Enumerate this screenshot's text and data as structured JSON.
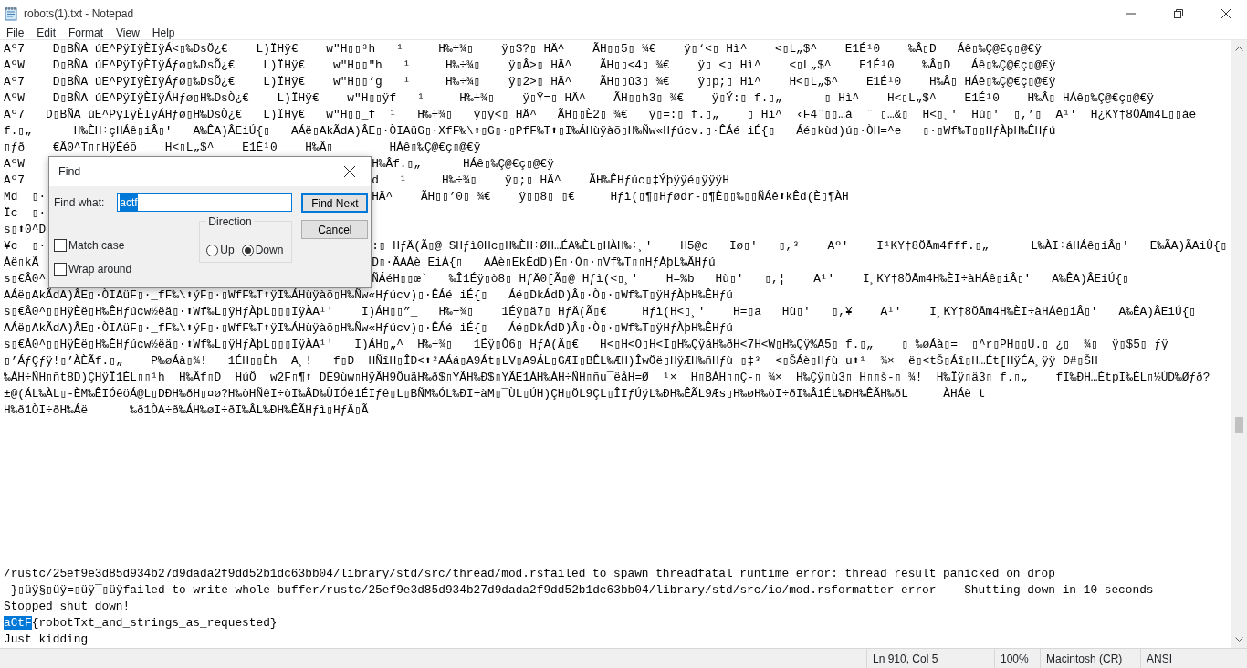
{
  "window": {
    "title": "robots(1).txt - Notepad"
  },
  "menu": [
    "File",
    "Edit",
    "Format",
    "View",
    "Help"
  ],
  "editor": {
    "upper_lines": [
      {
        "kind": "plain",
        "text": "Aº7    D▯BÑA úE^PÿIÿÈIÿÁ<▯‰DsÖ¿€    L)ÏHÿ€    w\"H▯▯³h   ¹     H‰÷¾▯    ÿ▯S?▯ HÄ^    ÃH▯▯5▯ ¾€    ÿ▯‘<▯ Hì^    <▯L„$^    E1É¹0    ‰Â▯D   Áê▯‰Ç@€ç▯@€ÿ"
      },
      {
        "kind": "plain",
        "text": "AºW    D▯BÑA úE^PÿIÿÈIÿÁƒø▯‰DsÕ¿€    L)ÏHÿ€    w\"H▯▯\"h   ¹     H‰÷¾▯    ÿ▯Â>▯ HÄ^    ÃH▯▯<4▯ ¾€    ÿ▯ <▯ Hì^    <▯L„$^    E1É¹0    ‰Â▯D   Áê▯‰Ç@€ç▯@€ÿ"
      },
      {
        "kind": "plain",
        "text": "Aº7    D▯BÑA úE^PÿIÿÈIÿÁƒø▯‰DsÕ¿€    L)ÏHÿ€    w\"H▯▯’g   ¹     H‰÷¾▯    ÿ▯2>▯ HÄ^    ÃH▯▯û3▯ ¾€    ÿ▯p;▯ Hì^    H<▯L„$^    E1É¹0    H‰Â▯ HÁê▯‰Ç@€ç▯@€ÿ"
      },
      {
        "kind": "plain",
        "text": "AºW    D▯BÑA úE^PÿIÿÈIÿÁHƒø▯H‰DsÒ¿€    L)ÏHÿ€    w\"H▯▯ÿf   ¹     H‰÷¾▯    ÿ▯Ÿ=▯ HÄ^    ÃH▯▯h3▯ ¾€    ÿ▯Ý:▯ f.▯„      ▯ Hì^    H<▯L„$^    E1É¹0    H‰Â▯ HÁê▯‰Ç@€ç▯@€ÿ"
      },
      {
        "kind": "plain",
        "text": "Aº7   D▯BÑA úE^PÿIÿÈIÿÁHƒø▯H‰DsÒ¿€   L)ÏHÿ€   w\"H▯▯_f  ¹   H‰÷¾▯   ÿ▯ÿ<▯ HÄ^   ÃH▯▯È2▯ ¾€   ÿ▯=:▯ f.▯„    ▯ Hì^  ‹F4¨▯▯…à  ¨ ▯…&▯  H<▯¸'  Hù▯'  ▯,’▯  A¹'  H¿KY†8ÖÅm4L▯▯áe"
      },
      {
        "kind": "plain",
        "text": "f.▯„      H‰ÈH÷çHÁê▯iÂ▯'   A‰ÊA)ÂEiÚ{▯   AÁë▯AkÃdA)ÂE▯·ÒIAüG▯·XfF‰\\⬆▯G▯·▯PfF‰T⬆▯I‰ÁHùÿàõ▯H‰Ñw«Hƒúcv.▯·ÊÁé iÉ{▯   Áé▯kùd)ú▯·ÒH=^e   ▯·▯Wf‰T▯▯HƒÀþH‰ÊHƒú"
      },
      {
        "kind": "plain",
        "text": "▯ƒð    €Â0^T▯▯HÿÈéõ    H<▯L„$^    E1É¹0    H‰Â▯        HÁê▯‰Ç@€ç▯@€ÿ"
      },
      {
        "kind": "split",
        "left": "AºW",
        "right": "H‰Âf.▯„      HÁê▯‰Ç@€ç▯@€ÿ"
      },
      {
        "kind": "split",
        "left": "Aº7",
        "right": "d   ¹     H‰÷¾▯    ÿ▯;▯ HÄ^    ÃH‰ÊHƒúc▯‡Ýþÿÿé▯ÿÿÿH"
      },
      {
        "kind": "split",
        "left": "Md  ▯·",
        "right": "HÄ^    ÃH▯▯’0▯ ¾€    ÿ▯▯8▯ ▯€     Hƒì(▯¶▯Hƒødr-▯¶È▯▯‰▯▯ÑÁê⬆kÊd(È▯¶ÀH"
      },
      {
        "kind": "split",
        "left": "Ïc  ▯·"
      },
      {
        "kind": "split",
        "left": "s▯⬆0^D"
      },
      {
        "kind": "split",
        "left": "¥c  ▯·",
        "right": ":▯ HƒÄ(Ã▯@ SHƒì0Hc▯H‰ÈH÷ØH…ÉA‰ÈL▯HÀH‰÷¸'    H5@c   Iø▯'   ▯,³    Aº'    I¹KY†8ÖÅm4fff.▯„      L‰ÀI÷áHÁê▯iÂ▯'   E‰ÃA)ÃAiÛ{▯"
      },
      {
        "kind": "split",
        "left": "Áë▯kÃ",
        "right": "D▯·ÂAÁè EiÀ{▯   AÁè▯EkÈdD)Ê▯·Ò▯·▯Vf‰T▯▯HƒÀþL‰ÂHƒú"
      },
      {
        "kind": "split",
        "left": "s▯€Â0^",
        "right": "ÑÁéH▯▯œ`   ‰Î1Éÿ▯ò8▯ HƒÄ0[Ã▯@ Hƒì(<▯¸'    H=%b   Hù▯'   ▯,¦    A¹'    I¸KY†8ÖÅm4H‰ÈI÷àHÁê▯iÂ▯'   A‰ÊA)ÂEiÚ{▯"
      },
      {
        "kind": "plain",
        "text": "AÁë▯AkÃdA)ÂE▯·ÒIAüF▯·_fF‰\\⬆ýF▯·▯WfF‰T⬆ÿI‰ÁHùÿàõ▯H‰Ñw«Hƒúcv)▯·ÊÁé iÉ{▯   Áé▯DkÁdD)Â▯·Ò▯·▯Wf‰T▯ÿHƒÀþH‰ÊHƒú"
      },
      {
        "kind": "plain",
        "text": "s▯€Â0^▯▯HÿÈë▯H‰ÊHƒúcw½ëä▯·⬆Wf‰L▯ÿHƒÀþL▯▯▯IÿÀA¹'    I)ÁH▯▯”_   H‰÷¾▯    1Éÿ▯ä7▯ HƒÄ(Ã▯€     Hƒì(H<▯¸'    H=▯a   Hù▯'   ▯,¥    A¹'    I¸KY†8ÖÅm4H‰ÈI÷àHÁê▯iÂ▯'   A‰ÊA)ÂEiÚ{▯"
      },
      {
        "kind": "plain",
        "text": "AÁë▯AkÃdA)ÂE▯·ÒIAüF▯·_fF‰\\⬆ýF▯·▯WfF‰T⬆ÿI‰ÁHùÿàõ▯H‰Ñw«Hƒúcv)▯·ÊÁé iÉ{▯   Áé▯DkÁdD)Â▯·Ò▯·▯Wf‰T▯ÿHƒÀþH‰ÊHƒú"
      },
      {
        "kind": "plain",
        "text": "s▯€Â0^▯▯HÿÈë▯H‰ÊHƒúcw½ëä▯·⬆Wf‰L▯ÿHƒÀþL▯▯▯IÿÀA¹'   I)ÁH▯„^  H‰÷¾▯   1Éÿ▯Ô6▯ HƒÄ(Ã▯€   H<▯H<O▯H<I▯H‰ÇÿáH‰ðH<7H<W▯H‰Çÿ%Å5▯ f.▯„    ▯ ‰øÁà▯=  ▯^r▯PH▯▯Ü.▯ ¿▯  ¾▯  ÿ▯$5▯ ƒÿ"
      },
      {
        "kind": "plain",
        "text": "▯’ÁƒÇƒÿ!▯’ÀÈÃf.▯„    P‰øÁà▯¾!   1ÉH▯▯Èh  A¸!   f▯D  HÑîH▯ÎD<⬆²AÁá▯A9Át▯LV▯A9ÁL▯GÆI▯BÊL‰ÆH)ÎwÖë▯HÿÆH‰ñHƒù ▯‡³  <▯ŠÁè▯Hƒù u⬆¹  ¾×  ë▯<tŠ▯Áî▯H…Ét[HÿÉA¸ÿÿ D#▯ŠH"
      },
      {
        "kind": "plain",
        "text": "‰ÁH÷ÑH▯ñt8D)ÇHÿÎ1ÉL▯▯¹h  H‰Âf▯D  HúÖ  w2F▯¶⬆ DÉ9ùw▯HÿÂH9ÖuäH‰ð$▯YÃH‰Ð$▯YÃE1ÀH‰ÁH÷ÑH▯ñu¯ëåH=Ø  ¹×  H▯BÁH▯▯Ç-▯ ¾×  H‰Çÿ▯ù3▯ H▯▯š-▯ ¾!  H‰Ïÿ▯ä3▯ f.▯„    fI‰ÐH…ÉtpI‰ÉL▯½ÙD‰Øƒð?"
      },
      {
        "kind": "plain",
        "text": "±@(ÁL‰ÀL▯-ÈM‰ÊIÓêöÁ@L▯DÐH‰ðH▯¤ø?H‰òHÑêI÷òI‰ÂD‰ÙIÓê1ÉIƒê▯L▯BÑM‰ÓL‰ÐI÷àM▯¯ÙL▯ÚH)ÇH▯ÖL9ÇL▯ÎIƒÚÿL‰ÐH‰ÊÃL9Æs▯H‰øH‰òI÷ðI‰Â1ÉL‰ÐH‰ÊÃH‰ðL     ÀHÁè t"
      },
      {
        "kind": "plain",
        "text": "H‰ð1ÒI÷ðH‰Áë      ‰ð1ÒA÷ð‰ÁH‰øI÷ðI‰ÂL‰ÐH‰ÊÃHƒì▯HƒÄ▯Ã"
      }
    ],
    "lower_lines": [
      {
        "kind": "plain",
        "text": "/rustc/25ef9e3d85d934b27d9dada2f9dd52b1dc63bb04/library/std/src/thread/mod.rsfailed to spawn threadfatal runtime error: thread result panicked on drop"
      },
      {
        "kind": "plain",
        "text": " }▯üÿ§▯üÿ=▯üÿ¯▯üÿfailed to write whole buffer/rustc/25ef9e3d85d934b27d9dada2f9dd52b1dc63bb04/library/std/src/io/mod.rsformatter error    Shutting down in 10 seconds"
      },
      {
        "kind": "plain",
        "text": "Stopped shut down!"
      },
      {
        "kind": "selection",
        "selected_text": "aCtF",
        "text": "{robotTxt_and_strings_as_requested}"
      },
      {
        "kind": "plain",
        "text": "Just kidding"
      }
    ]
  },
  "find_dialog": {
    "title": "Find",
    "label": "Find what:",
    "value": "actf",
    "value_selected": true,
    "buttons": [
      {
        "label": "Find Next",
        "default": true
      },
      {
        "label": "Cancel",
        "default": false
      }
    ],
    "direction": {
      "label": "Direction",
      "options": [
        {
          "label": "Up",
          "selected": false
        },
        {
          "label": "Down",
          "selected": true
        }
      ]
    },
    "checkboxes": [
      {
        "label": "Match case",
        "checked": false
      },
      {
        "label": "Wrap around",
        "checked": false
      }
    ]
  },
  "status_bar": [
    "Ln 910, Col 5",
    "100%",
    "Macintosh (CR)",
    "ANSI"
  ]
}
